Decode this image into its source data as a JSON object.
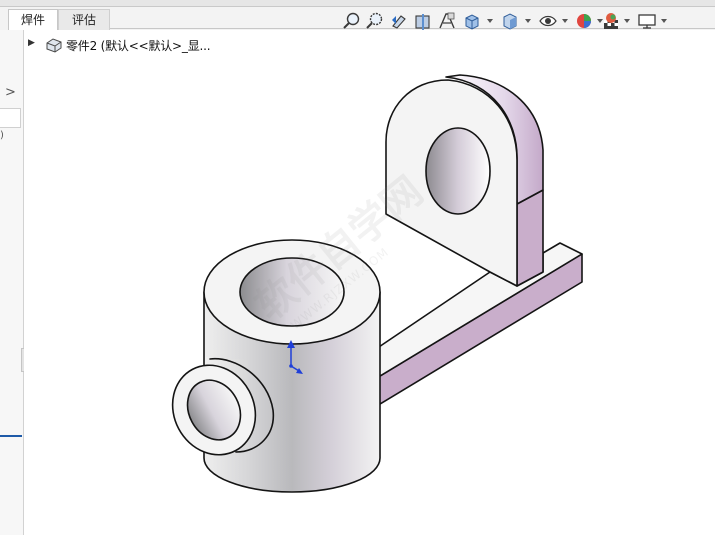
{
  "tabs": {
    "weldments": "焊件",
    "evaluate": "评估"
  },
  "feature_tree": {
    "part_label": "零件2  (默认<<默认>_显..."
  },
  "toolbar": {
    "icons": [
      "zoom-to-fit-icon",
      "zoom-to-area-icon",
      "previous-view-icon",
      "section-view-icon",
      "dynamic-annotation-icon",
      "view-orientation-icon",
      "display-style-icon",
      "hide-show-items-icon",
      "edit-appearance-icon",
      "apply-scene-icon",
      "view-settings-icon"
    ]
  },
  "watermark": {
    "text": "软件自学网",
    "url": "WWW.RJZXW.COM"
  },
  "colors": {
    "lavender_face": "#c9aecb",
    "white_face": "#f4f4f4",
    "triad_blue": "#1f3fd8"
  }
}
